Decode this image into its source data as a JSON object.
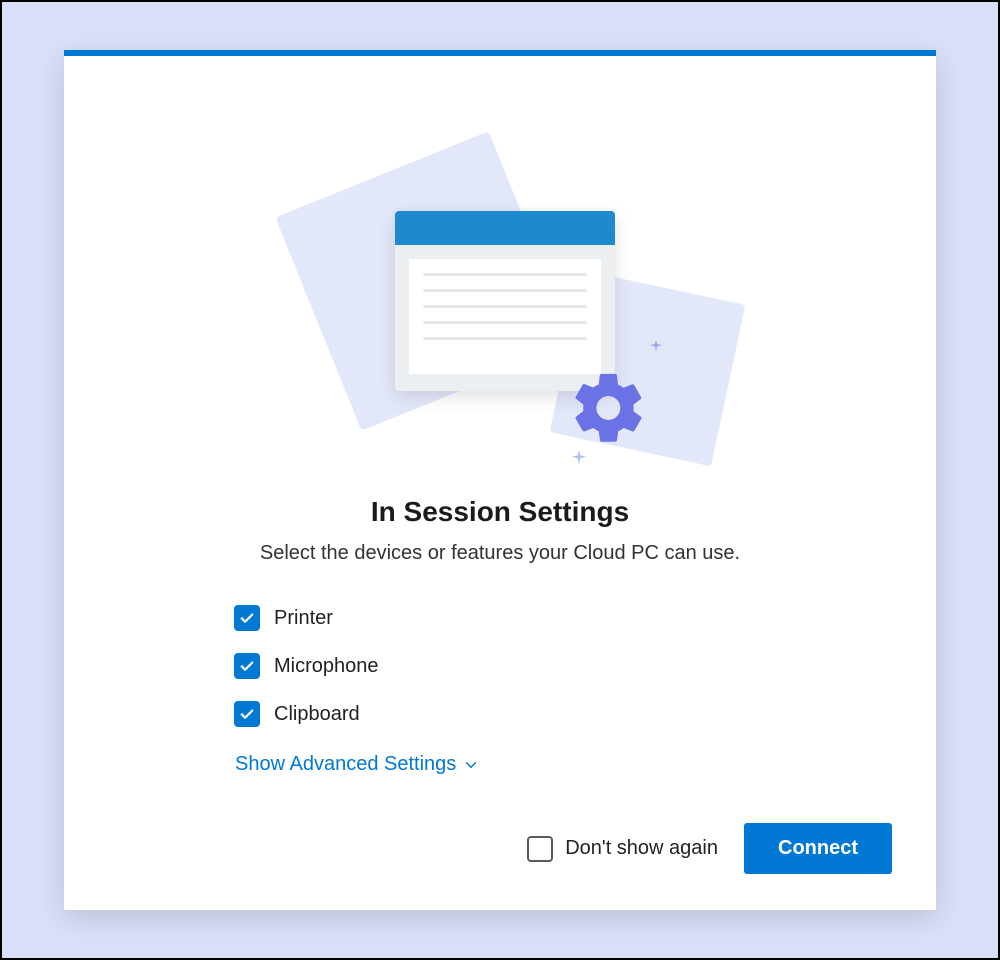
{
  "dialog": {
    "title": "In Session Settings",
    "subtitle": "Select the devices or features your Cloud PC can use.",
    "options": [
      {
        "label": "Printer",
        "checked": true
      },
      {
        "label": "Microphone",
        "checked": true
      },
      {
        "label": "Clipboard",
        "checked": true
      }
    ],
    "advanced_link": "Show Advanced Settings",
    "dont_show_label": "Don't show again",
    "dont_show_checked": false,
    "connect_label": "Connect"
  },
  "colors": {
    "accent": "#0078d4",
    "illustration_bg": "#e3e7fa",
    "gear": "#6a72e5"
  }
}
